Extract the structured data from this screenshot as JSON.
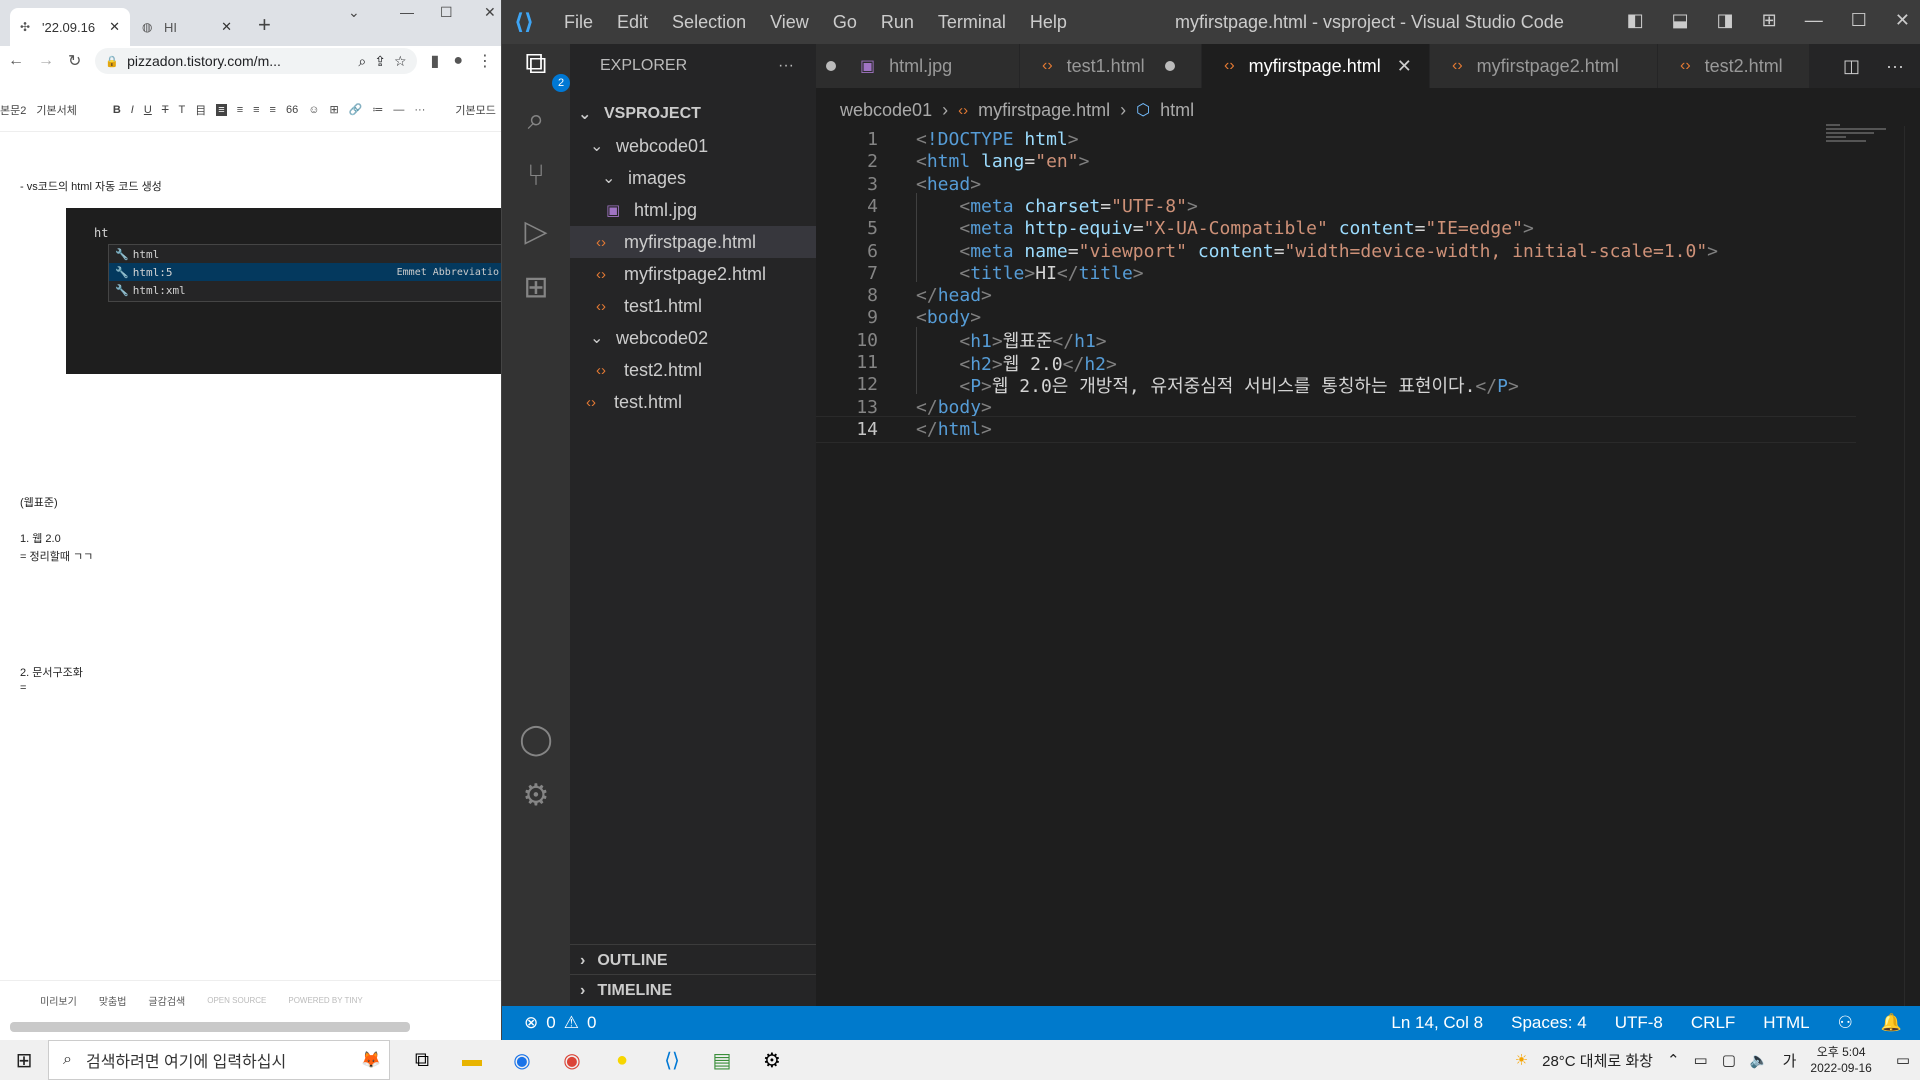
{
  "chrome": {
    "tab_active_title": "'22.09.16",
    "tab_inactive_title": "HI",
    "url": "pizzadon.tistory.com/m...",
    "editor_toolbar": [
      "본문2",
      "기본서체",
      "B",
      "I",
      "U",
      "T",
      "T",
      "目",
      "≡",
      "≡",
      "≡",
      "≡",
      "66",
      "☺",
      "⊞",
      "🔗",
      "≔",
      "—",
      "···",
      "기본모드"
    ],
    "content": {
      "line1": "- vs코드의 html 자동 코드 생성",
      "typed": "ht",
      "suggestions": [
        {
          "label": "html",
          "hint": ""
        },
        {
          "label": "html:5",
          "hint": "Emmet Abbreviatio"
        },
        {
          "label": "html:xml",
          "hint": ""
        }
      ],
      "section": "(웹표준)",
      "item1": "1. 웹 2.0",
      "item1_note": "= 정리할때 ㄱㄱ",
      "item2": "2. 문서구조화",
      "item2_note": "="
    },
    "bottom_bar": [
      "미리보기",
      "맞춤법",
      "글감검색",
      "OPEN SOURCE",
      "POWERED BY TINY"
    ]
  },
  "vscode": {
    "menu": [
      "File",
      "Edit",
      "Selection",
      "View",
      "Go",
      "Run",
      "Terminal",
      "Help"
    ],
    "window_title": "myfirstpage.html - vsproject - Visual Studio Code",
    "activity_badge": "2",
    "explorer_label": "EXPLORER",
    "tree": {
      "root": "VSPROJECT",
      "webcode01": "webcode01",
      "images": "images",
      "html_jpg": "html.jpg",
      "myfirstpage": "myfirstpage.html",
      "myfirstpage2": "myfirstpage2.html",
      "test1": "test1.html",
      "webcode02": "webcode02",
      "test2": "test2.html",
      "test": "test.html"
    },
    "outline_label": "OUTLINE",
    "timeline_label": "TIMELINE",
    "tabs": [
      "html.jpg",
      "test1.html",
      "myfirstpage.html",
      "myfirstpage2.html",
      "test2.html"
    ],
    "breadcrumb": [
      "webcode01",
      "myfirstpage.html",
      "html"
    ],
    "code_lines": [
      "<!DOCTYPE html>",
      "<html lang=\"en\">",
      "<head>",
      "    <meta charset=\"UTF-8\">",
      "    <meta http-equiv=\"X-UA-Compatible\" content=\"IE=edge\">",
      "    <meta name=\"viewport\" content=\"width=device-width, initial-scale=1.0\">",
      "    <title>HI</title>",
      "</head>",
      "<body>",
      "    <h1>웹표준</h1>",
      "    <h2>웹 2.0</h2>",
      "    <P>웹 2.0은 개방적, 유저중심적 서비스를 통칭하는 표현이다.</P>",
      "</body>",
      "</html>"
    ],
    "status": {
      "errors": "0",
      "warnings": "0",
      "position": "Ln 14, Col 8",
      "spaces": "Spaces: 4",
      "encoding": "UTF-8",
      "eol": "CRLF",
      "language": "HTML"
    }
  },
  "taskbar": {
    "search_placeholder": "검색하려면 여기에 입력하십시",
    "weather": "28°C 대체로 화창",
    "ime": "가",
    "time": "오후 5:04",
    "date": "2022-09-16"
  }
}
